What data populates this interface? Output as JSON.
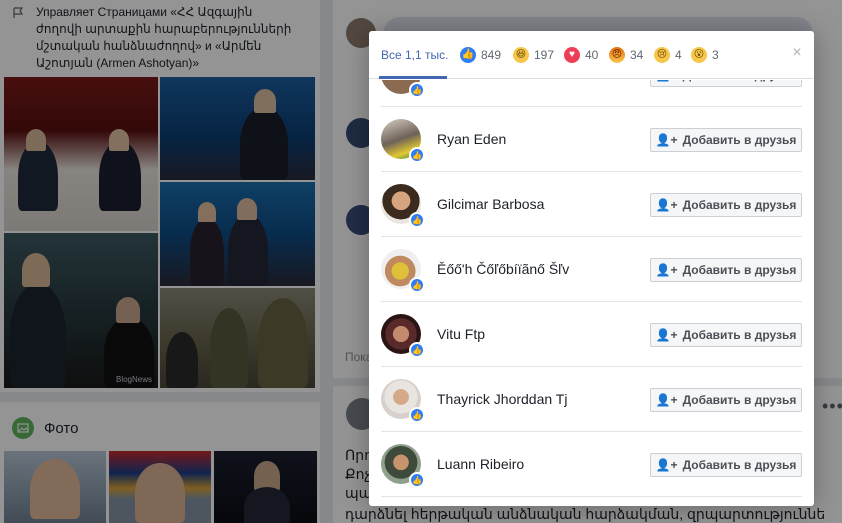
{
  "left_panel": {
    "managed_text": "Управляет Страницами «ՀՀ Ազգային ժողովի արտաքին հարաբերությունների մշտական հանձնաժողով» и «Արմեն Աշոտյան (Armen Ashotyan)»",
    "photo_watermark": "BlogNews",
    "photo_section_label": "Фото"
  },
  "feed": {
    "show_more_label": "Пока",
    "post_text_lines": [
      "Որո",
      "Քոչ",
      "պա"
    ],
    "post_bottom_line": "դարձնել հերթական անձնական հարձակման, զրպարտությունների և"
  },
  "modal": {
    "tabs": [
      {
        "label": "Все 1,1 тыс.",
        "icon": null
      },
      {
        "label": "849",
        "icon": "like-icon"
      },
      {
        "label": "197",
        "icon": "haha-icon"
      },
      {
        "label": "40",
        "icon": "love-icon"
      },
      {
        "label": "34",
        "icon": "angry-icon"
      },
      {
        "label": "4",
        "icon": "sad-icon"
      },
      {
        "label": "3",
        "icon": "wow-icon"
      }
    ],
    "close_label": "×",
    "add_friend_label": "Добавить в друзья",
    "people": [
      {
        "name": "Ryan Eden"
      },
      {
        "name": "Gilcimar Barbosa"
      },
      {
        "name": "Ěőő'h Čőľőbíïãnő Šľv"
      },
      {
        "name": "Vitu Ftp"
      },
      {
        "name": "Thayrick Jhorddan Tj"
      },
      {
        "name": "Luann Ribeiro"
      }
    ]
  },
  "colors": {
    "accent": "#4267b2",
    "like": "#2e7df5",
    "love": "#ee3d56",
    "haha": "#f7c64b"
  }
}
